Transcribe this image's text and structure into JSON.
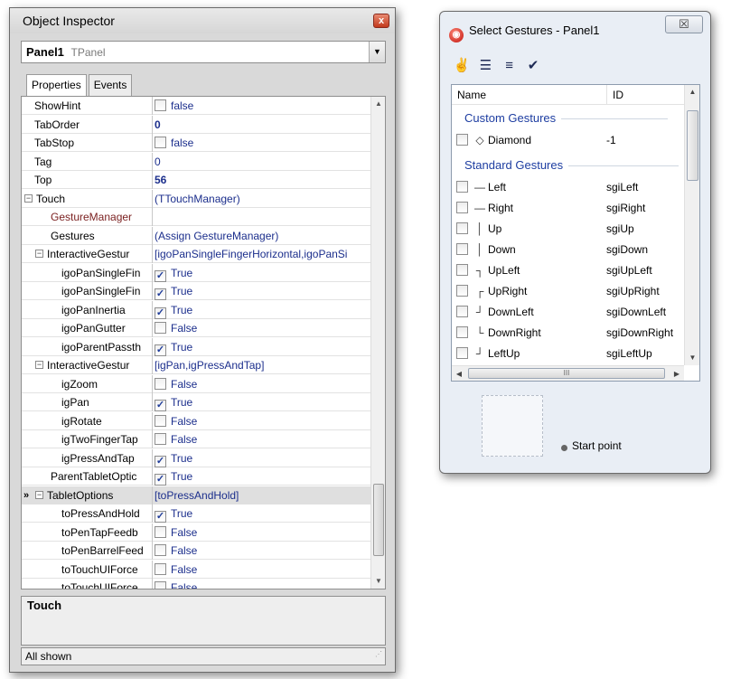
{
  "inspector": {
    "title": "Object Inspector",
    "close_glyph": "x",
    "object_name": "Panel1",
    "object_type": "TPanel",
    "tabs": [
      "Properties",
      "Events"
    ],
    "properties": [
      {
        "name": "ShowHint",
        "value": "false",
        "checkbox": true,
        "checked": false
      },
      {
        "name": "TabOrder",
        "value": "0",
        "bold": true
      },
      {
        "name": "TabStop",
        "value": "false",
        "checkbox": true,
        "checked": false
      },
      {
        "name": "Tag",
        "value": "0"
      },
      {
        "name": "Top",
        "value": "56",
        "bold": true
      },
      {
        "name": "Touch",
        "value": "(TTouchManager)",
        "expander": "minus",
        "level": 0
      },
      {
        "name": "GestureManager",
        "value": "",
        "level": 1,
        "event": true
      },
      {
        "name": "Gestures",
        "value": "(Assign GestureManager)",
        "level": 1
      },
      {
        "name": "InteractiveGestur",
        "value": "[igoPanSingleFingerHorizontal,igoPanSi",
        "expander": "minus",
        "level": 1
      },
      {
        "name": "igoPanSingleFin",
        "value": "True",
        "checkbox": true,
        "checked": true,
        "level": 2
      },
      {
        "name": "igoPanSingleFin",
        "value": "True",
        "checkbox": true,
        "checked": true,
        "level": 2
      },
      {
        "name": "igoPanInertia",
        "value": "True",
        "checkbox": true,
        "checked": true,
        "level": 2
      },
      {
        "name": "igoPanGutter",
        "value": "False",
        "checkbox": true,
        "checked": false,
        "level": 2
      },
      {
        "name": "igoParentPassth",
        "value": "True",
        "checkbox": true,
        "checked": true,
        "level": 2
      },
      {
        "name": "InteractiveGestur",
        "value": "[igPan,igPressAndTap]",
        "expander": "minus",
        "level": 1
      },
      {
        "name": "igZoom",
        "value": "False",
        "checkbox": true,
        "checked": false,
        "level": 2
      },
      {
        "name": "igPan",
        "value": "True",
        "checkbox": true,
        "checked": true,
        "level": 2
      },
      {
        "name": "igRotate",
        "value": "False",
        "checkbox": true,
        "checked": false,
        "level": 2
      },
      {
        "name": "igTwoFingerTap",
        "value": "False",
        "checkbox": true,
        "checked": false,
        "level": 2
      },
      {
        "name": "igPressAndTap",
        "value": "True",
        "checkbox": true,
        "checked": true,
        "level": 2
      },
      {
        "name": "ParentTabletOptic",
        "value": "True",
        "checkbox": true,
        "checked": true,
        "level": 1
      },
      {
        "name": "TabletOptions",
        "value": "[toPressAndHold]",
        "expander": "minus",
        "level": 1,
        "selected": true
      },
      {
        "name": "toPressAndHold",
        "value": "True",
        "checkbox": true,
        "checked": true,
        "level": 2
      },
      {
        "name": "toPenTapFeedb",
        "value": "False",
        "checkbox": true,
        "checked": false,
        "level": 2
      },
      {
        "name": "toPenBarrelFeed",
        "value": "False",
        "checkbox": true,
        "checked": false,
        "level": 2
      },
      {
        "name": "toTouchUIForce",
        "value": "False",
        "checkbox": true,
        "checked": false,
        "level": 2
      },
      {
        "name": "toTouchUIForce",
        "value": "False",
        "checkbox": true,
        "checked": false,
        "level": 2
      }
    ],
    "current_indicator": "»",
    "description_title": "Touch",
    "status": "All shown"
  },
  "gestures_dialog": {
    "title": "Select Gestures - Panel1",
    "close_glyph": "☒",
    "toolbar": [
      {
        "icon": "gesture-wizard-icon",
        "glyph": "✌"
      },
      {
        "icon": "numbered-list-icon",
        "glyph": "☰"
      },
      {
        "icon": "bullet-list-icon",
        "glyph": "≡"
      },
      {
        "icon": "check-all-icon",
        "glyph": "✔"
      }
    ],
    "columns": {
      "name": "Name",
      "id": "ID"
    },
    "groups": [
      {
        "label": "Custom Gestures",
        "items": [
          {
            "name": "Diamond",
            "id": "-1",
            "glyph": "◇"
          }
        ]
      },
      {
        "label": "Standard Gestures",
        "items": [
          {
            "name": "Left",
            "id": "sgiLeft",
            "glyph": "—"
          },
          {
            "name": "Right",
            "id": "sgiRight",
            "glyph": "—"
          },
          {
            "name": "Up",
            "id": "sgiUp",
            "glyph": "│"
          },
          {
            "name": "Down",
            "id": "sgiDown",
            "glyph": "│"
          },
          {
            "name": "UpLeft",
            "id": "sgiUpLeft",
            "glyph": "┐"
          },
          {
            "name": "UpRight",
            "id": "sgiUpRight",
            "glyph": "┌"
          },
          {
            "name": "DownLeft",
            "id": "sgiDownLeft",
            "glyph": "┘"
          },
          {
            "name": "DownRight",
            "id": "sgiDownRight",
            "glyph": "└"
          },
          {
            "name": "LeftUp",
            "id": "sgiLeftUp",
            "glyph": "┘"
          }
        ]
      }
    ],
    "hscroll_glyph": "III",
    "preview_label": "Start point"
  }
}
